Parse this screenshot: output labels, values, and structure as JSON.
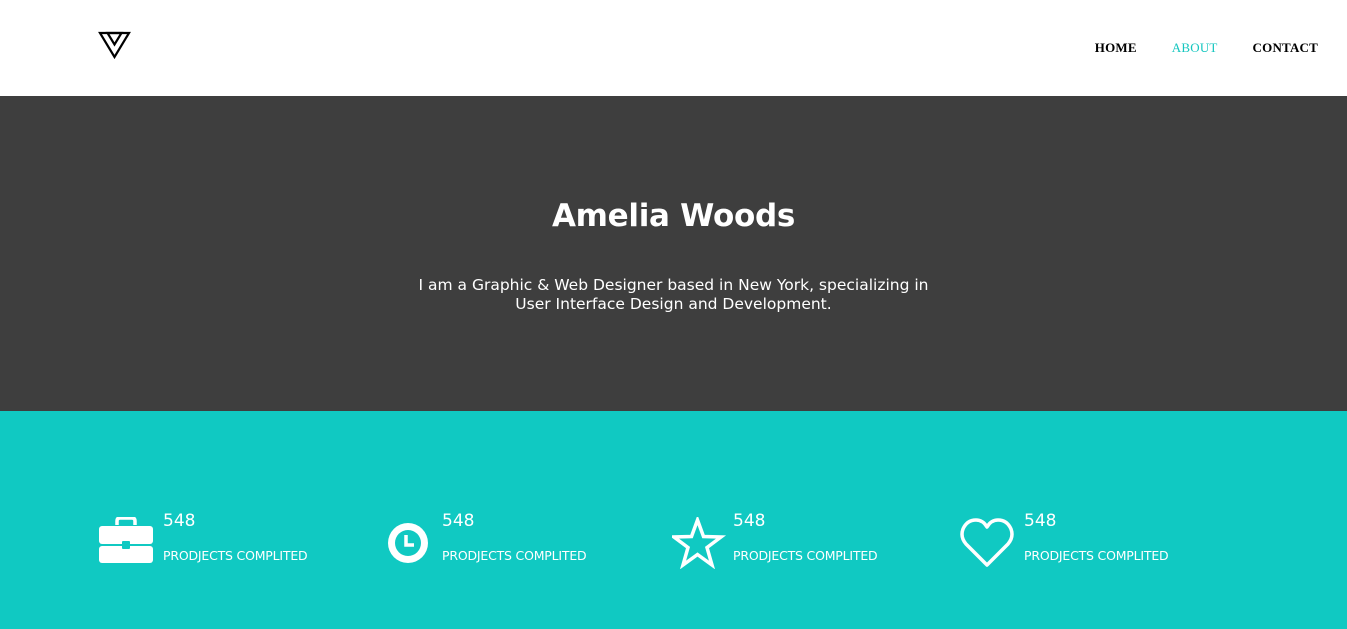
{
  "header": {
    "logo_icon": "inverted-triangle-logo-icon",
    "nav": [
      {
        "label": "HOME",
        "active": false
      },
      {
        "label": "ABOUT",
        "active": true
      },
      {
        "label": "CONTACT",
        "active": false
      }
    ]
  },
  "hero": {
    "name": "Amelia Woods",
    "bio": "I am a Graphic & Web Designer based in New York, specializing in User Interface Design and Development."
  },
  "stats": [
    {
      "icon": "briefcase-icon",
      "number": "548",
      "label": "PRODJECTS COMPLITED"
    },
    {
      "icon": "clock-icon",
      "number": "548",
      "label": "PRODJECTS COMPLITED"
    },
    {
      "icon": "star-icon",
      "number": "548",
      "label": "PRODJECTS COMPLITED"
    },
    {
      "icon": "heart-icon",
      "number": "548",
      "label": "PRODJECTS COMPLITED"
    }
  ],
  "colors": {
    "accent": "#14c6bf",
    "hero_bg": "#3e3e3e",
    "stats_bg": "#10c9c2",
    "text_on_dark": "#ffffff"
  }
}
